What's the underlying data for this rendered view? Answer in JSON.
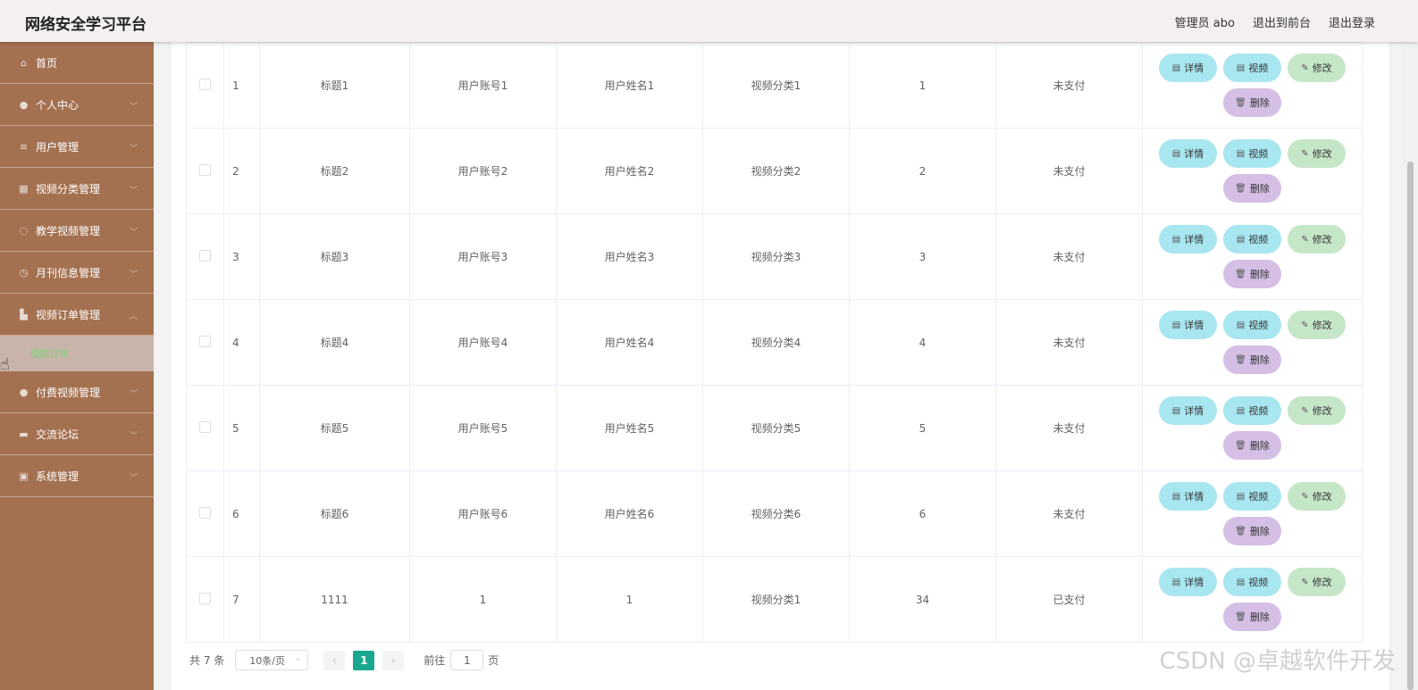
{
  "header": {
    "title": "网络安全学习平台",
    "admin": "管理员 abo",
    "to_front": "退出到前台",
    "logout": "退出登录"
  },
  "sidebar": {
    "items": [
      {
        "label": "首页",
        "icon": "home-icon"
      },
      {
        "label": "个人中心",
        "icon": "user-icon"
      },
      {
        "label": "用户管理",
        "icon": "sliders-icon"
      },
      {
        "label": "视频分类管理",
        "icon": "grid-icon"
      },
      {
        "label": "教学视频管理",
        "icon": "globe-icon"
      },
      {
        "label": "月刊信息管理",
        "icon": "clock-icon"
      },
      {
        "label": "视频订单管理",
        "icon": "chart-icon"
      }
    ],
    "submenu": "视频订单",
    "items_after": [
      {
        "label": "付费视频管理",
        "icon": "location-icon"
      },
      {
        "label": "交流论坛",
        "icon": "book-icon"
      },
      {
        "label": "系统管理",
        "icon": "clipboard-icon"
      }
    ]
  },
  "table": {
    "rows": [
      {
        "index": "1",
        "title": "标题1",
        "account": "用户账号1",
        "name": "用户姓名1",
        "category": "视频分类1",
        "amount": "1",
        "status": "未支付"
      },
      {
        "index": "2",
        "title": "标题2",
        "account": "用户账号2",
        "name": "用户姓名2",
        "category": "视频分类2",
        "amount": "2",
        "status": "未支付"
      },
      {
        "index": "3",
        "title": "标题3",
        "account": "用户账号3",
        "name": "用户姓名3",
        "category": "视频分类3",
        "amount": "3",
        "status": "未支付"
      },
      {
        "index": "4",
        "title": "标题4",
        "account": "用户账号4",
        "name": "用户姓名4",
        "category": "视频分类4",
        "amount": "4",
        "status": "未支付"
      },
      {
        "index": "5",
        "title": "标题5",
        "account": "用户账号5",
        "name": "用户姓名5",
        "category": "视频分类5",
        "amount": "5",
        "status": "未支付"
      },
      {
        "index": "6",
        "title": "标题6",
        "account": "用户账号6",
        "name": "用户姓名6",
        "category": "视频分类6",
        "amount": "6",
        "status": "未支付"
      },
      {
        "index": "7",
        "title": "1111",
        "account": "1",
        "name": "1",
        "category": "视频分类1",
        "amount": "34",
        "status": "已支付"
      }
    ],
    "actions": {
      "detail": "详情",
      "video": "视频",
      "edit": "修改",
      "delete": "删除"
    }
  },
  "pager": {
    "total": "共 7 条",
    "page_size": "10条/页",
    "current": "1",
    "goto_label": "前往",
    "goto_value": "1",
    "page_unit": "页"
  },
  "watermark": "CSDN @卓越软件开发"
}
